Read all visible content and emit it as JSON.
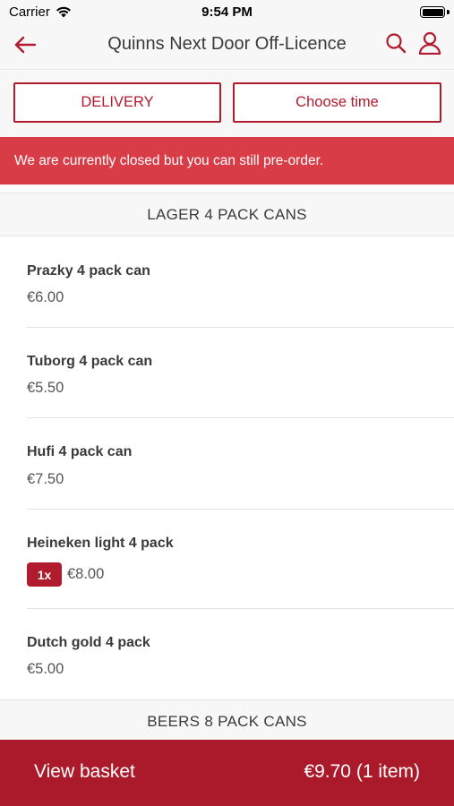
{
  "status_bar": {
    "carrier": "Carrier",
    "time": "9:54 PM"
  },
  "nav": {
    "title": "Quinns Next Door Off-Licence",
    "back_icon": "arrow-left-icon",
    "search_icon": "search-icon",
    "user_icon": "user-icon"
  },
  "options": {
    "delivery_label": "DELIVERY",
    "time_label": "Choose time"
  },
  "banner": {
    "text": "We are currently closed but you can still pre-order."
  },
  "sections": [
    {
      "title": "LAGER 4 PACK CANS",
      "items": [
        {
          "name": "Prazky 4 pack can",
          "price": "€6.00"
        },
        {
          "name": "Tuborg 4 pack can",
          "price": "€5.50"
        },
        {
          "name": "Hufi 4 pack can",
          "price": "€7.50"
        },
        {
          "name": "Heineken light 4 pack",
          "price": "€8.00",
          "quantity": "1x"
        },
        {
          "name": "Dutch gold 4 pack",
          "price": "€5.00"
        }
      ]
    },
    {
      "title": "BEERS 8 PACK CANS",
      "items": []
    }
  ],
  "basket": {
    "label": "View basket",
    "total": "€9.70 (1 item)"
  },
  "colors": {
    "brand": "#b01b2e",
    "banner": "#d83c47",
    "basket_bar": "#ab1a2b",
    "header_bg": "#f7f7f7"
  }
}
